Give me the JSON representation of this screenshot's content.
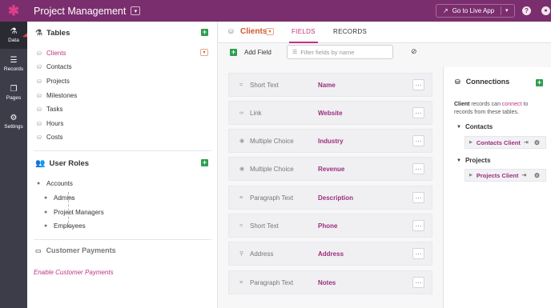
{
  "topbar": {
    "logo": "✱",
    "title": "Project Management",
    "title_chevron": "▾",
    "live_app_label": "Go to Live App",
    "live_app_caret": "▾",
    "help": "?",
    "user": "●"
  },
  "leftnav": {
    "items": [
      {
        "label": "Data",
        "icon": "⚗"
      },
      {
        "label": "Records",
        "icon": "☰"
      },
      {
        "label": "Pages",
        "icon": "❐"
      },
      {
        "label": "Settings",
        "icon": "⚙"
      }
    ]
  },
  "tables_panel": {
    "header": "Tables",
    "tables": [
      "Clients",
      "Contacts",
      "Projects",
      "Milestones",
      "Tasks",
      "Hours",
      "Costs"
    ],
    "active_table": "Clients",
    "user_roles_header": "User Roles",
    "accounts_label": "Accounts",
    "roles": [
      "Admins",
      "Project Managers",
      "Employees"
    ],
    "customer_payments_label": "Customer Payments",
    "enable_payments_link": "Enable Customer Payments"
  },
  "main": {
    "table_name": "Clients",
    "tabs": [
      "FIELDS",
      "RECORDS"
    ],
    "active_tab": "FIELDS",
    "add_field_label": "Add Field",
    "filter_placeholder": "Filter fields by name",
    "more_label": "···",
    "fields": [
      {
        "type": "Short Text",
        "name": "Name",
        "icon": "="
      },
      {
        "type": "Link",
        "name": "Website",
        "icon": "∞"
      },
      {
        "type": "Multiple Choice",
        "name": "Industry",
        "icon": "◉"
      },
      {
        "type": "Multiple Choice",
        "name": "Revenue",
        "icon": "◉"
      },
      {
        "type": "Paragraph Text",
        "name": "Description",
        "icon": "≡"
      },
      {
        "type": "Short Text",
        "name": "Phone",
        "icon": "="
      },
      {
        "type": "Address",
        "name": "Address",
        "icon": "⚲"
      },
      {
        "type": "Paragraph Text",
        "name": "Notes",
        "icon": "≡"
      }
    ]
  },
  "connections": {
    "header": "Connections",
    "desc_subject": "Client",
    "desc_mid": " records can ",
    "desc_link": "connect",
    "desc_end": " to records from these tables.",
    "groups": [
      {
        "name": "Contacts",
        "item": "Contacts Client"
      },
      {
        "name": "Projects",
        "item": "Projects Client"
      }
    ]
  },
  "colors": {
    "topbar": "#7b2e6e",
    "leftnav": "#3d3d4a",
    "accent": "#c0337f",
    "table_title": "#d05a2b",
    "add_green": "#2e9e4f"
  }
}
